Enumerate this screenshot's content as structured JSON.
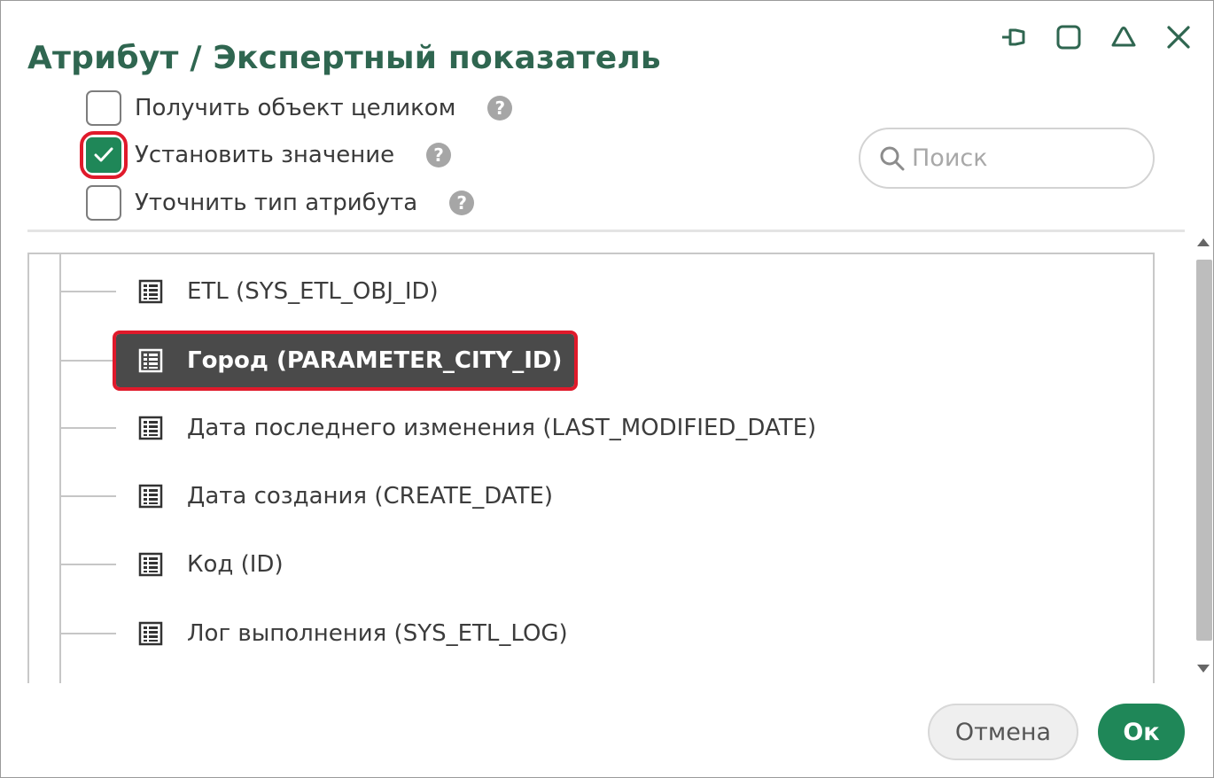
{
  "dialog": {
    "title": "Атрибут / Экспертный показатель"
  },
  "window_controls": [
    {
      "name": "pin-icon"
    },
    {
      "name": "maximize-icon"
    },
    {
      "name": "collapse-icon"
    },
    {
      "name": "close-icon"
    }
  ],
  "options": [
    {
      "label": "Получить объект целиком",
      "checked": false
    },
    {
      "label": "Установить значение",
      "checked": true
    },
    {
      "label": "Уточнить тип атрибута",
      "checked": false
    }
  ],
  "help_glyph": "?",
  "search": {
    "placeholder": "Поиск",
    "value": ""
  },
  "tree": {
    "items": [
      {
        "label": "ETL (SYS_ETL_OBJ_ID)",
        "icon": "table-icon",
        "selected": false
      },
      {
        "label": "Город (PARAMETER_CITY_ID)",
        "icon": "table-icon",
        "selected": true
      },
      {
        "label": "Дата последнего изменения (LAST_MODIFIED_DATE)",
        "icon": "table-icon",
        "selected": false
      },
      {
        "label": "Дата создания (CREATE_DATE)",
        "icon": "table-icon",
        "selected": false
      },
      {
        "label": "Код (ID)",
        "icon": "table-icon",
        "selected": false
      },
      {
        "label": "Лог выполнения (SYS_ETL_LOG)",
        "icon": "table-icon",
        "selected": false
      }
    ]
  },
  "footer": {
    "cancel_label": "Отмена",
    "ok_label": "Ок"
  },
  "colors": {
    "accent": "#1f8758",
    "title": "#2f6650",
    "highlight": "#e01a2b",
    "selected_bg": "#4a4a4a"
  }
}
